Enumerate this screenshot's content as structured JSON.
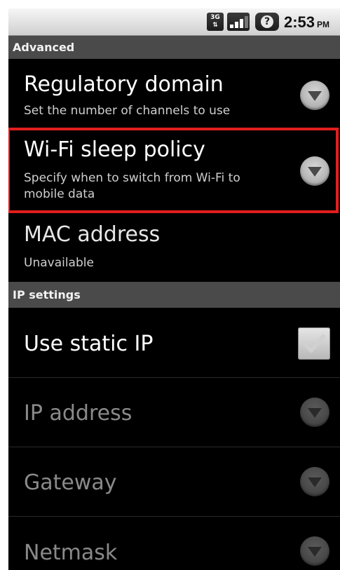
{
  "status_bar": {
    "network_type": "3G",
    "time": "2:53",
    "ampm": "PM",
    "icons": [
      "3g-data-icon",
      "signal-strength-icon",
      "battery-unknown-icon"
    ]
  },
  "sections": {
    "advanced": "Advanced",
    "ip_settings": "IP settings"
  },
  "advanced_items": [
    {
      "title": "Regulatory domain",
      "summary": "Set the number of channels to use",
      "widget": "dropdown-arrow-icon"
    },
    {
      "title": "Wi-Fi sleep policy",
      "summary": "Specify when to switch from Wi-Fi to mobile data",
      "widget": "dropdown-arrow-icon",
      "highlighted": true
    },
    {
      "title": "MAC address",
      "summary": "Unavailable"
    }
  ],
  "ip_items": [
    {
      "title": "Use static IP",
      "widget": "checkbox-icon",
      "checked": false
    },
    {
      "title": "IP address",
      "widget": "dropdown-arrow-icon",
      "enabled": false
    },
    {
      "title": "Gateway",
      "widget": "dropdown-arrow-icon",
      "enabled": false
    },
    {
      "title": "Netmask",
      "widget": "dropdown-arrow-icon",
      "enabled": false
    }
  ],
  "colors": {
    "background": "#000000",
    "section_header": "#4a4a4a",
    "highlight_border": "#e21e1e",
    "disabled_text": "#8a8a8a"
  }
}
